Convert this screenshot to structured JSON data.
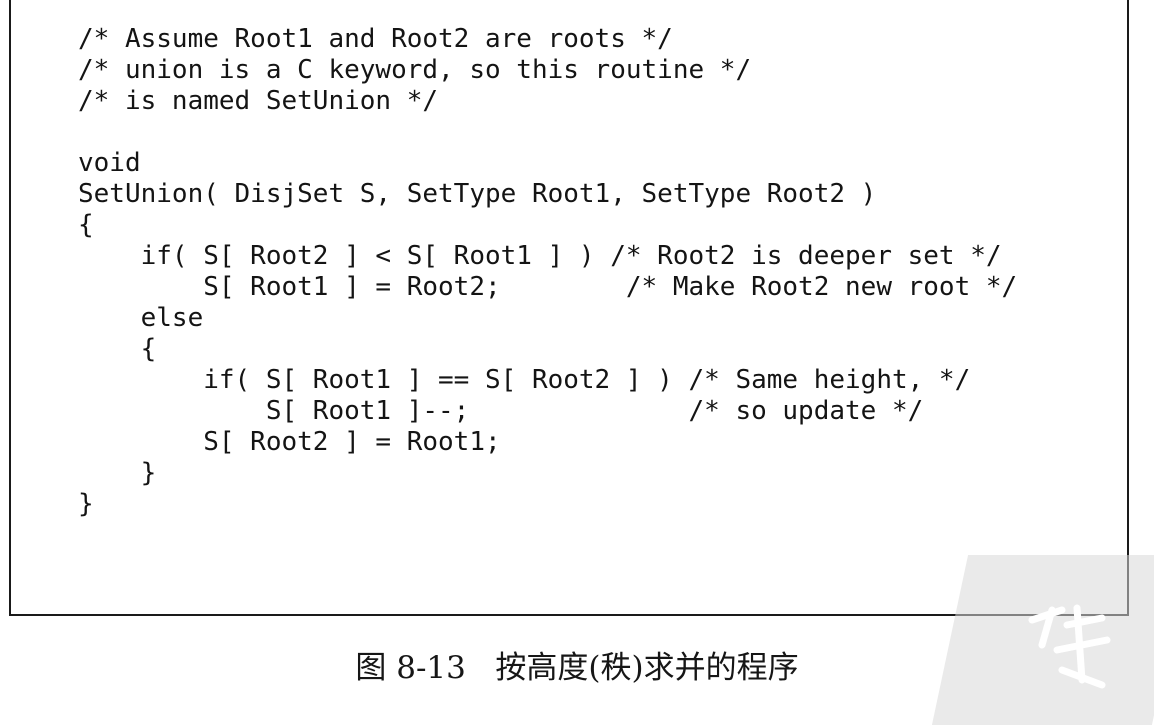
{
  "code": {
    "lines": [
      "/* Assume Root1 and Root2 are roots */",
      "/* union is a C keyword, so this routine */",
      "/* is named SetUnion */",
      "",
      "void",
      "SetUnion( DisjSet S, SetType Root1, SetType Root2 )",
      "{",
      "    if( S[ Root2 ] < S[ Root1 ] ) /* Root2 is deeper set */",
      "        S[ Root1 ] = Root2;        /* Make Root2 new root */",
      "    else",
      "    {",
      "        if( S[ Root1 ] == S[ Root2 ] ) /* Same height, */",
      "            S[ Root1 ]--;              /* so update */",
      "        S[ Root2 ] = Root1;",
      "    }",
      "}"
    ]
  },
  "caption": "图 8-13   按高度(秩)求并的程序",
  "colors": {
    "text": "#141414",
    "frame": "#1a1a1a",
    "watermark": "#d9d9d9"
  }
}
